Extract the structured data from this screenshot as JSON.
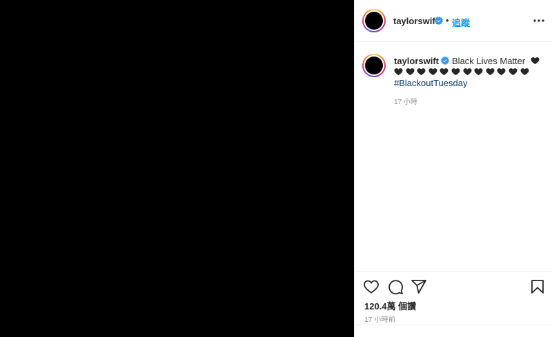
{
  "post": {
    "image_color": "#000000"
  },
  "header": {
    "username": "taylorswift",
    "separator": "•",
    "follow_label": "追蹤",
    "verified_icon": "verified-badge-icon",
    "more_icon": "more-options-icon"
  },
  "caption": {
    "username": "taylorswift",
    "text": "Black Lives Matter",
    "heart_icon": "black-heart-icon",
    "heart_count_first_line": 1,
    "heart_count_second_line": 12,
    "hashtag": "#BlackoutTuesday",
    "time": "17 小時"
  },
  "actions": {
    "like_icon": "heart-outline-icon",
    "comment_icon": "comment-icon",
    "share_icon": "paper-plane-icon",
    "save_icon": "bookmark-icon",
    "views": "120.4萬 個讚",
    "time": "17 小時前"
  },
  "colors": {
    "link_blue": "#0095f6",
    "hashtag_blue": "#00376b",
    "muted_gray": "#8e8e8e",
    "verified_blue": "#3897f0"
  }
}
